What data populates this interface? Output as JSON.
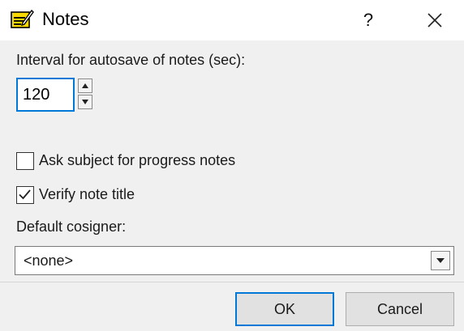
{
  "window": {
    "title": "Notes",
    "help_label": "?",
    "icons": {
      "app": "notes-pencil-icon",
      "close": "close-icon"
    }
  },
  "autosave": {
    "label": "Interval for autosave of notes (sec):",
    "value": "120"
  },
  "options": [
    {
      "label": "Ask subject for progress notes",
      "checked": false
    },
    {
      "label": "Verify note title",
      "checked": true
    }
  ],
  "cosigner": {
    "label": "Default cosigner:",
    "selected": "<none>"
  },
  "buttons": {
    "ok": "OK",
    "cancel": "Cancel"
  },
  "colors": {
    "focus_accent": "#0078d7",
    "dialog_bg": "#f0f0f0",
    "titlebar_bg": "#ffffff"
  }
}
